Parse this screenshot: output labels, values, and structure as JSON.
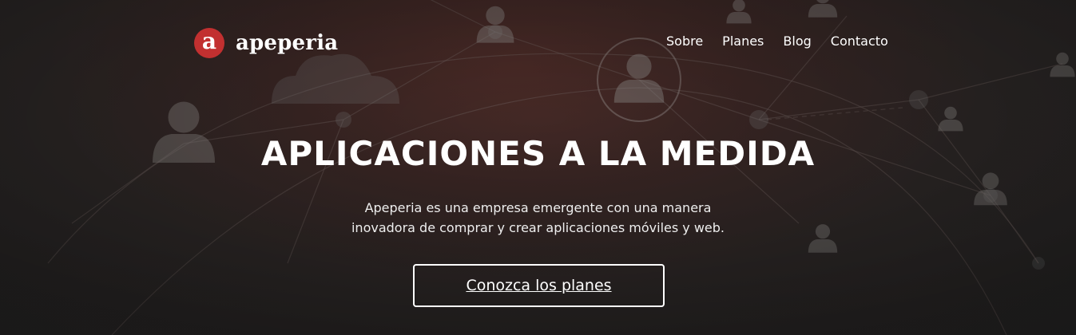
{
  "brand": {
    "logo_letter": "a",
    "name": "apeperia",
    "accent_color": "#c23030"
  },
  "nav": {
    "items": [
      {
        "label": "Sobre"
      },
      {
        "label": "Planes"
      },
      {
        "label": "Blog"
      },
      {
        "label": "Contacto"
      }
    ]
  },
  "hero": {
    "title": "APLICACIONES A LA MEDIDA",
    "subtitle_line1": "Apeperia es una empresa emergente con una manera",
    "subtitle_line2": "inovadora de comprar y crear aplicaciones móviles y web.",
    "cta_label": "Conozca los planes",
    "background": "network-of-people-icons"
  }
}
